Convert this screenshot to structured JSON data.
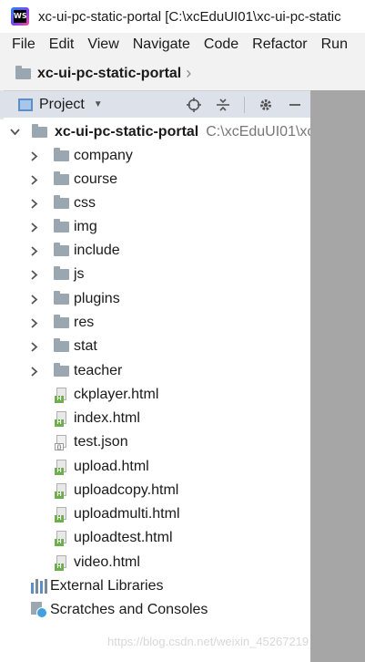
{
  "window": {
    "title": "xc-ui-pc-static-portal [C:\\xcEduUI01\\xc-ui-pc-static",
    "app_icon": "webstorm-icon"
  },
  "menu": [
    "File",
    "Edit",
    "View",
    "Navigate",
    "Code",
    "Refactor",
    "Run"
  ],
  "breadcrumb": {
    "project": "xc-ui-pc-static-portal"
  },
  "panel": {
    "title": "Project"
  },
  "tree": {
    "root": {
      "name": "xc-ui-pc-static-portal",
      "path": "C:\\xcEduUI01\\xc"
    },
    "folders": [
      "company",
      "course",
      "css",
      "img",
      "include",
      "js",
      "plugins",
      "res",
      "stat",
      "teacher"
    ],
    "files": [
      {
        "name": "ckplayer.html",
        "type": "html"
      },
      {
        "name": "index.html",
        "type": "html"
      },
      {
        "name": "test.json",
        "type": "json"
      },
      {
        "name": "upload.html",
        "type": "html"
      },
      {
        "name": "uploadcopy.html",
        "type": "html"
      },
      {
        "name": "uploadmulti.html",
        "type": "html"
      },
      {
        "name": "uploadtest.html",
        "type": "html"
      },
      {
        "name": "video.html",
        "type": "html"
      }
    ],
    "external_libraries": "External Libraries",
    "scratches": "Scratches and Consoles"
  },
  "watermark": "https://blog.csdn.net/weixin_45267219",
  "colors": {
    "panel_header": "#dde2ea",
    "folder": "#9aa7b0",
    "html_badge": "#6fae4e",
    "right_pane": "#a6a6a6"
  }
}
